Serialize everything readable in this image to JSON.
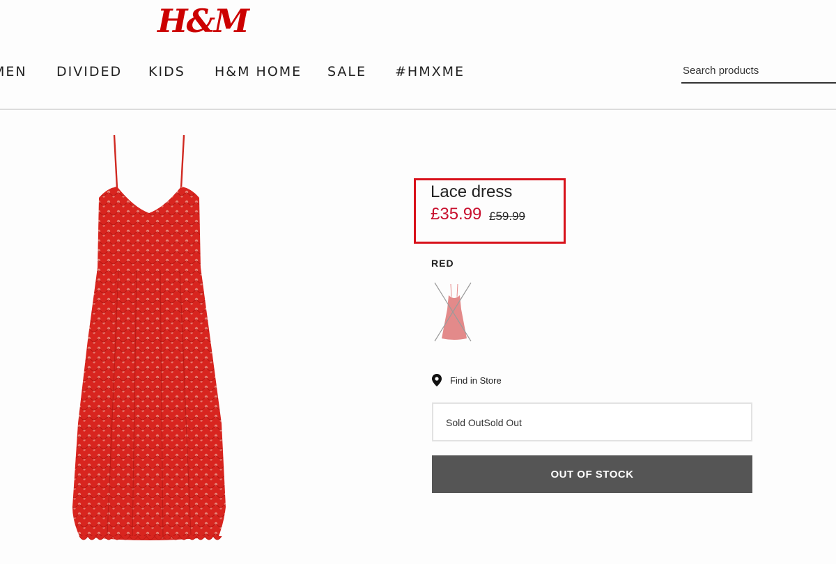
{
  "header": {
    "logo": "H&M",
    "nav": [
      {
        "label": "MEN"
      },
      {
        "label": "DIVIDED"
      },
      {
        "label": "KIDS"
      },
      {
        "label": "H&M HOME"
      },
      {
        "label": "SALE"
      },
      {
        "label": "#HMXME"
      }
    ],
    "search_placeholder": "Search products"
  },
  "product": {
    "name": "Lace dress",
    "sale_price": "£35.99",
    "original_price": "£59.99",
    "color_label": "RED",
    "find_in_store": "Find in Store",
    "size_select_value": "Sold OutSold Out",
    "button_label": "OUT OF STOCK"
  },
  "colors": {
    "brand": "#cc0000",
    "highlight_box": "#d8121b",
    "sale_price": "#c8102e",
    "button": "#555555",
    "dress": "#d4201f"
  },
  "icons": {
    "find_in_store": "location-pin-icon",
    "swatch": "dress-thumbnail-unavailable"
  }
}
